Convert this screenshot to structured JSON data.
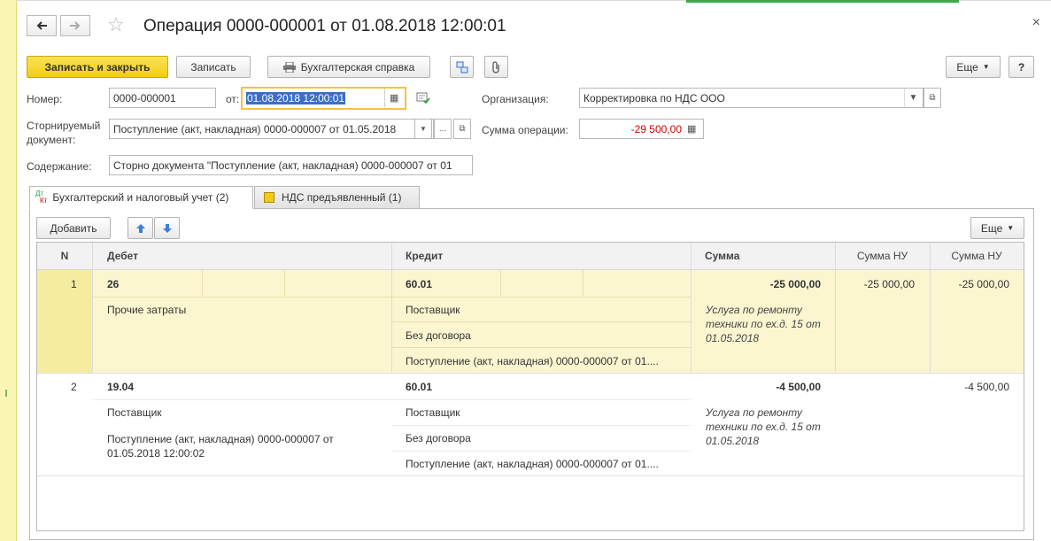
{
  "window": {
    "title": "Операция 0000-000001 от 01.08.2018 12:00:01",
    "back_icon": "arrow-left-icon",
    "forward_icon": "arrow-right-icon",
    "star_icon": "star-icon",
    "close_symbol": "×"
  },
  "toolbar": {
    "save_close": "Записать и закрыть",
    "save": "Записать",
    "report": "Бухгалтерская справка",
    "more": "Еще",
    "help": "?"
  },
  "form": {
    "number_label": "Номер:",
    "number_value": "0000-000001",
    "date_label": "от:",
    "date_value": "01.08.2018 12:00:01",
    "org_label": "Организация:",
    "org_value": "Корректировка по НДС ООО",
    "storno_label_1": "Сторнируемый",
    "storno_label_2": "документ:",
    "storno_value": "Поступление (акт, накладная) 0000-000007 от 01.05.2018",
    "sum_label": "Сумма операции:",
    "sum_value": "-29 500,00",
    "content_label": "Содержание:",
    "content_value": "Сторно документа \"Поступление (акт, накладная) 0000-000007 от 01"
  },
  "tabs": [
    {
      "label": "Бухгалтерский и налоговый учет (2)",
      "icon_text": "Дт Кт"
    },
    {
      "label": "НДС предъявленный (1)"
    }
  ],
  "table_toolbar": {
    "add": "Добавить",
    "more": "Еще"
  },
  "table": {
    "columns": [
      "N",
      "Дебет",
      "Кредит",
      "Сумма",
      "Сумма НУ",
      "Сумма НУ"
    ],
    "rows": [
      {
        "n": "1",
        "debit_account": "26",
        "debit_sub": [
          "Прочие затраты"
        ],
        "credit_account": "60.01",
        "credit_sub": [
          "Поставщик",
          "Без договора",
          "Поступление (акт, накладная) 0000-000007 от 01...."
        ],
        "sum": "-25 000,00",
        "comment": "Услуга по ремонту техники по ех.д. 15 от 01.05.2018",
        "sum_nu_debit": "-25 000,00",
        "sum_nu_credit": "-25 000,00"
      },
      {
        "n": "2",
        "debit_account": "19.04",
        "debit_sub": [
          "Поставщик",
          "Поступление (акт, накладная) 0000-000007 от 01.05.2018 12:00:02"
        ],
        "credit_account": "60.01",
        "credit_sub": [
          "Поставщик",
          "Без договора",
          "Поступление (акт, накладная) 0000-000007 от 01...."
        ],
        "sum": "-4 500,00",
        "comment": "Услуга по ремонту техники по ех.д. 15 от 01.05.2018",
        "sum_nu_debit": "",
        "sum_nu_credit": "-4 500,00"
      }
    ]
  },
  "colors": {
    "accent_yellow": "#f2cc18",
    "negative": "#d10000",
    "selected_row": "#fbf6d0"
  }
}
